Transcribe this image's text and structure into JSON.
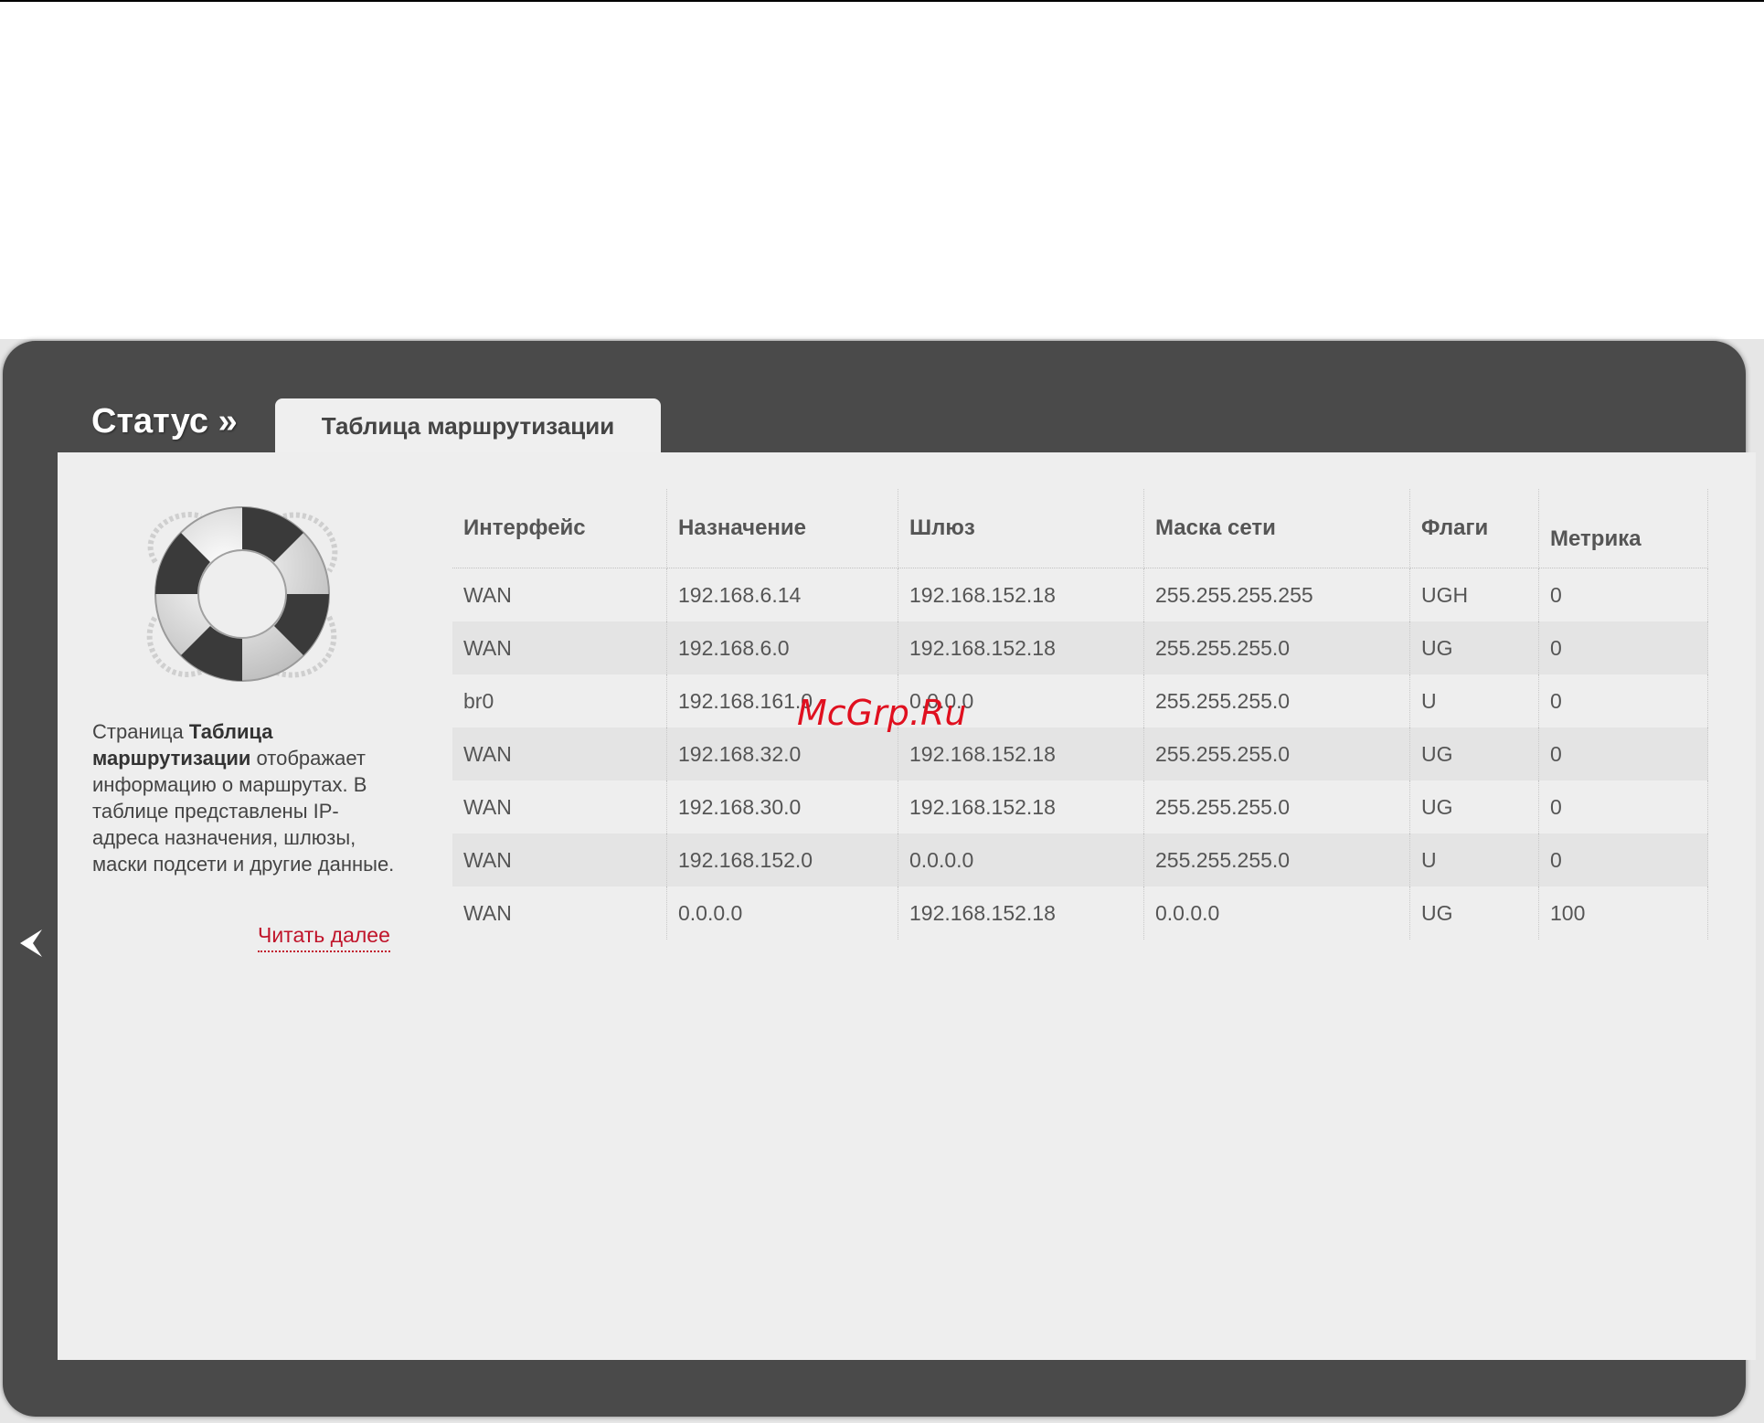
{
  "breadcrumb": {
    "section": "Статус »"
  },
  "tab": {
    "active_label": "Таблица маршрутизации"
  },
  "sidebar": {
    "text_before": "Страница ",
    "text_bold": "Таблица маршрутизации",
    "text_after": " отображает информацию о маршрутах. В таблице представлены IP-адреса назначения, шлюзы, маски подсети и другие данные.",
    "read_more": "Читать далее"
  },
  "table": {
    "headers": [
      "Интерфейс",
      "Назначение",
      "Шлюз",
      "Маска сети",
      "Флаги",
      "Метрика"
    ],
    "rows": [
      [
        "WAN",
        "192.168.6.14",
        "192.168.152.18",
        "255.255.255.255",
        "UGH",
        "0"
      ],
      [
        "WAN",
        "192.168.6.0",
        "192.168.152.18",
        "255.255.255.0",
        "UG",
        "0"
      ],
      [
        "br0",
        "192.168.161.0",
        "0.0.0.0",
        "255.255.255.0",
        "U",
        "0"
      ],
      [
        "WAN",
        "192.168.32.0",
        "192.168.152.18",
        "255.255.255.0",
        "UG",
        "0"
      ],
      [
        "WAN",
        "192.168.30.0",
        "192.168.152.18",
        "255.255.255.0",
        "UG",
        "0"
      ],
      [
        "WAN",
        "192.168.152.0",
        "0.0.0.0",
        "255.255.255.0",
        "U",
        "0"
      ],
      [
        "WAN",
        "0.0.0.0",
        "192.168.152.18",
        "0.0.0.0",
        "UG",
        "100"
      ]
    ]
  },
  "watermark": "McGrp.Ru",
  "colors": {
    "frame": "#4a4a4a",
    "panel": "#eeeeee",
    "accent_link": "#c0142a",
    "watermark": "#e0101f"
  },
  "icons": {
    "lifebuoy": "lifebuoy-icon",
    "back": "chevron-left-icon"
  }
}
